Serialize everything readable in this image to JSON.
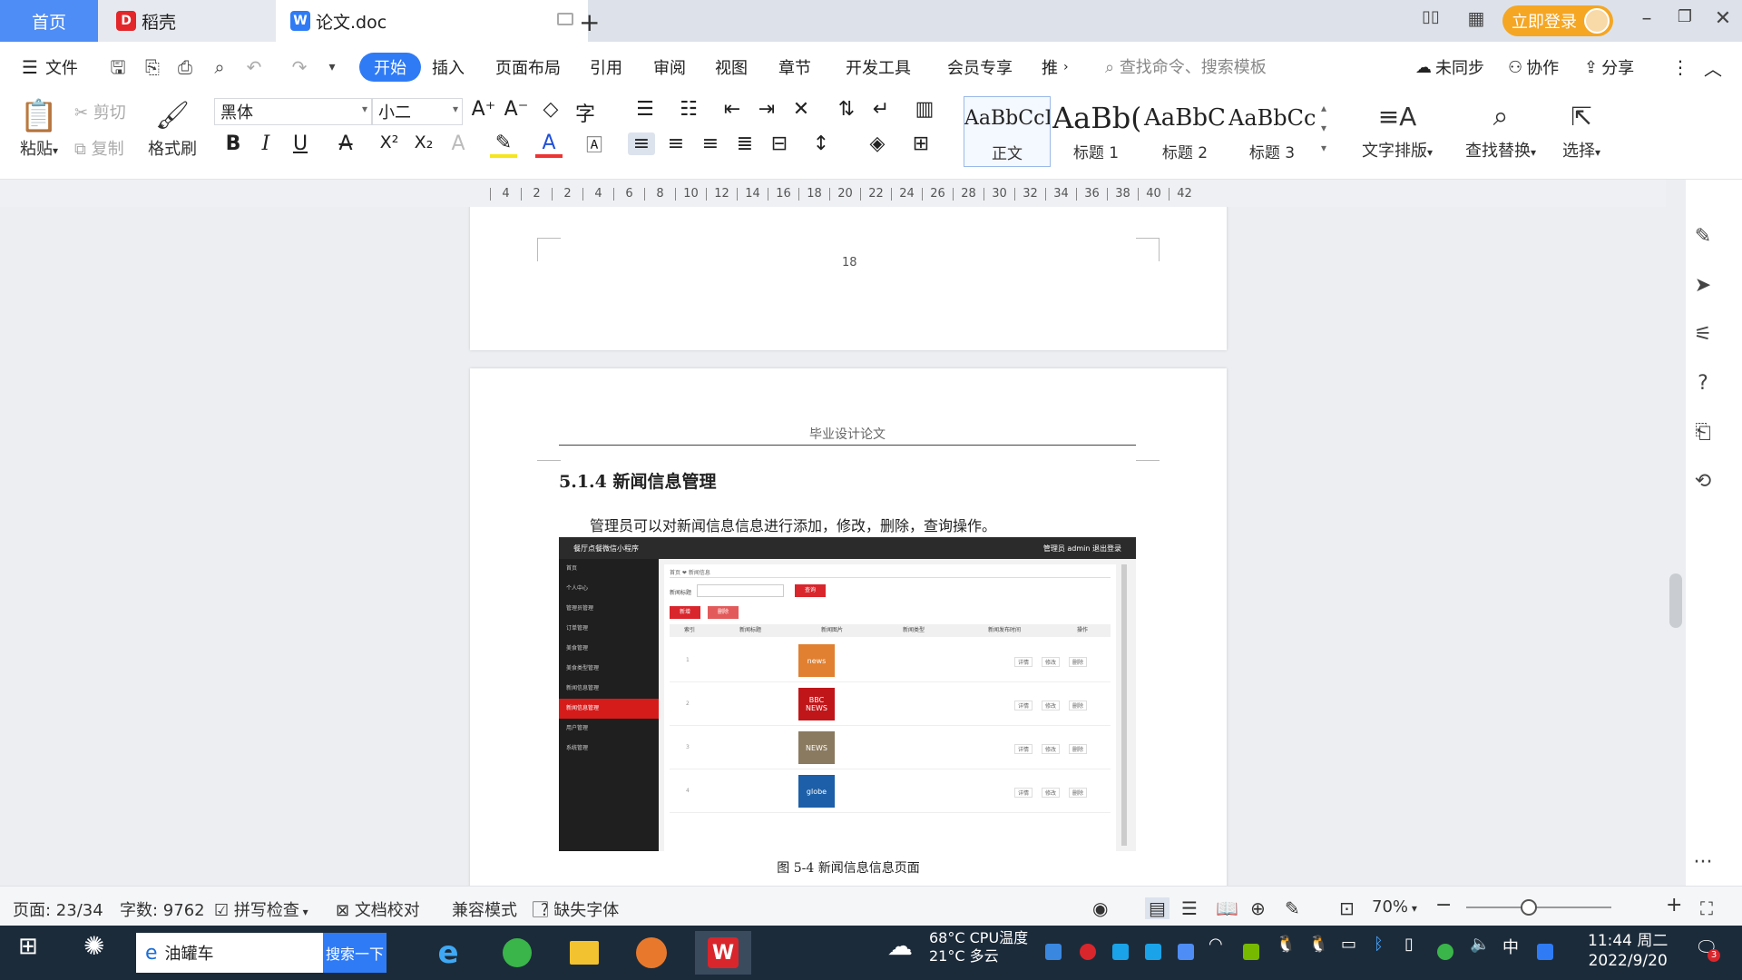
{
  "tabs": {
    "home": "首页",
    "docer": "稻壳",
    "document": "论文.doc"
  },
  "title_right": {
    "login": "立即登录"
  },
  "menu": {
    "file": "文件",
    "items": [
      "开始",
      "插入",
      "页面布局",
      "引用",
      "审阅",
      "视图",
      "章节",
      "开发工具",
      "会员专享",
      "推"
    ],
    "search_placeholder": "查找命令、搜索模板",
    "sync": "未同步",
    "collab": "协作",
    "share": "分享"
  },
  "ribbon": {
    "paste": "粘贴",
    "cut": "剪切",
    "copy": "复制",
    "format_painter": "格式刷",
    "font_name": "黑体",
    "font_size": "小二",
    "styles": [
      {
        "sample": "AaBbCcI",
        "label": "正文"
      },
      {
        "sample": "AaBb(",
        "label": "标题 1"
      },
      {
        "sample": "AaBbC",
        "label": "标题 2"
      },
      {
        "sample": "AaBbCc",
        "label": "标题 3"
      }
    ],
    "text_layout": "文字排版",
    "find_replace": "查找替换",
    "select": "选择"
  },
  "ruler": [
    "4",
    "2",
    "2",
    "4",
    "6",
    "8",
    "10",
    "12",
    "14",
    "16",
    "18",
    "20",
    "22",
    "24",
    "26",
    "28",
    "30",
    "32",
    "34",
    "36",
    "38",
    "40",
    "42"
  ],
  "document": {
    "page_number": "18",
    "header": "毕业设计论文",
    "section_title": "5.1.4  新闻信息管理",
    "paragraph": "管理员可以对新闻信息信息进行添加，修改，删除，查询操作。",
    "caption": "图 5-4  新闻信息信息页面",
    "screenshot": {
      "app_title": "餐厅点餐微信小程序",
      "header_right": "管理员 admin    退出登录",
      "breadcrumb": "首页 ❤ 新闻信息",
      "search_label": "新闻标题",
      "search_btn": "查询",
      "add_btn": "新增",
      "del_btn": "删除",
      "table_headers": [
        "索引",
        "新闻标题",
        "新闻图片",
        "新闻类型",
        "新闻发布时间",
        "操作"
      ],
      "side_items": [
        "首页",
        "个人中心",
        "管理员管理",
        "订单管理",
        "美食管理",
        "美食类型管理",
        "新闻信息管理",
        "新闻信息管理",
        "用户管理",
        "系统管理"
      ],
      "rows": [
        {
          "index": "1",
          "img": "news",
          "img_color": "#e08030"
        },
        {
          "index": "2",
          "img": "BBC NEWS",
          "img_color": "#c0161a"
        },
        {
          "index": "3",
          "img": "NEWS",
          "img_color": "#8a7a60"
        },
        {
          "index": "4",
          "img": "globe",
          "img_color": "#1d5fa8"
        }
      ],
      "row_actions": [
        "详情",
        "修改",
        "删除"
      ]
    }
  },
  "status": {
    "page": "页面: 23/34",
    "words": "字数: 9762",
    "spell": "拼写检查",
    "proof": "文档校对",
    "compat": "兼容模式",
    "missing_font": "缺失字体",
    "zoom": "70%"
  },
  "taskbar": {
    "search_text": "油罐车",
    "search_btn": "搜索一下",
    "weather": "21°C 多云",
    "cpu": "68°C CPU温度",
    "ime": "中",
    "time": "11:44 周二",
    "date": "2022/9/20",
    "notify_count": "3"
  },
  "colors": {
    "accent": "#2f7bf5",
    "login": "#f5a623",
    "wps_red": "#d9262c",
    "taskbar": "#1c2b3a"
  }
}
